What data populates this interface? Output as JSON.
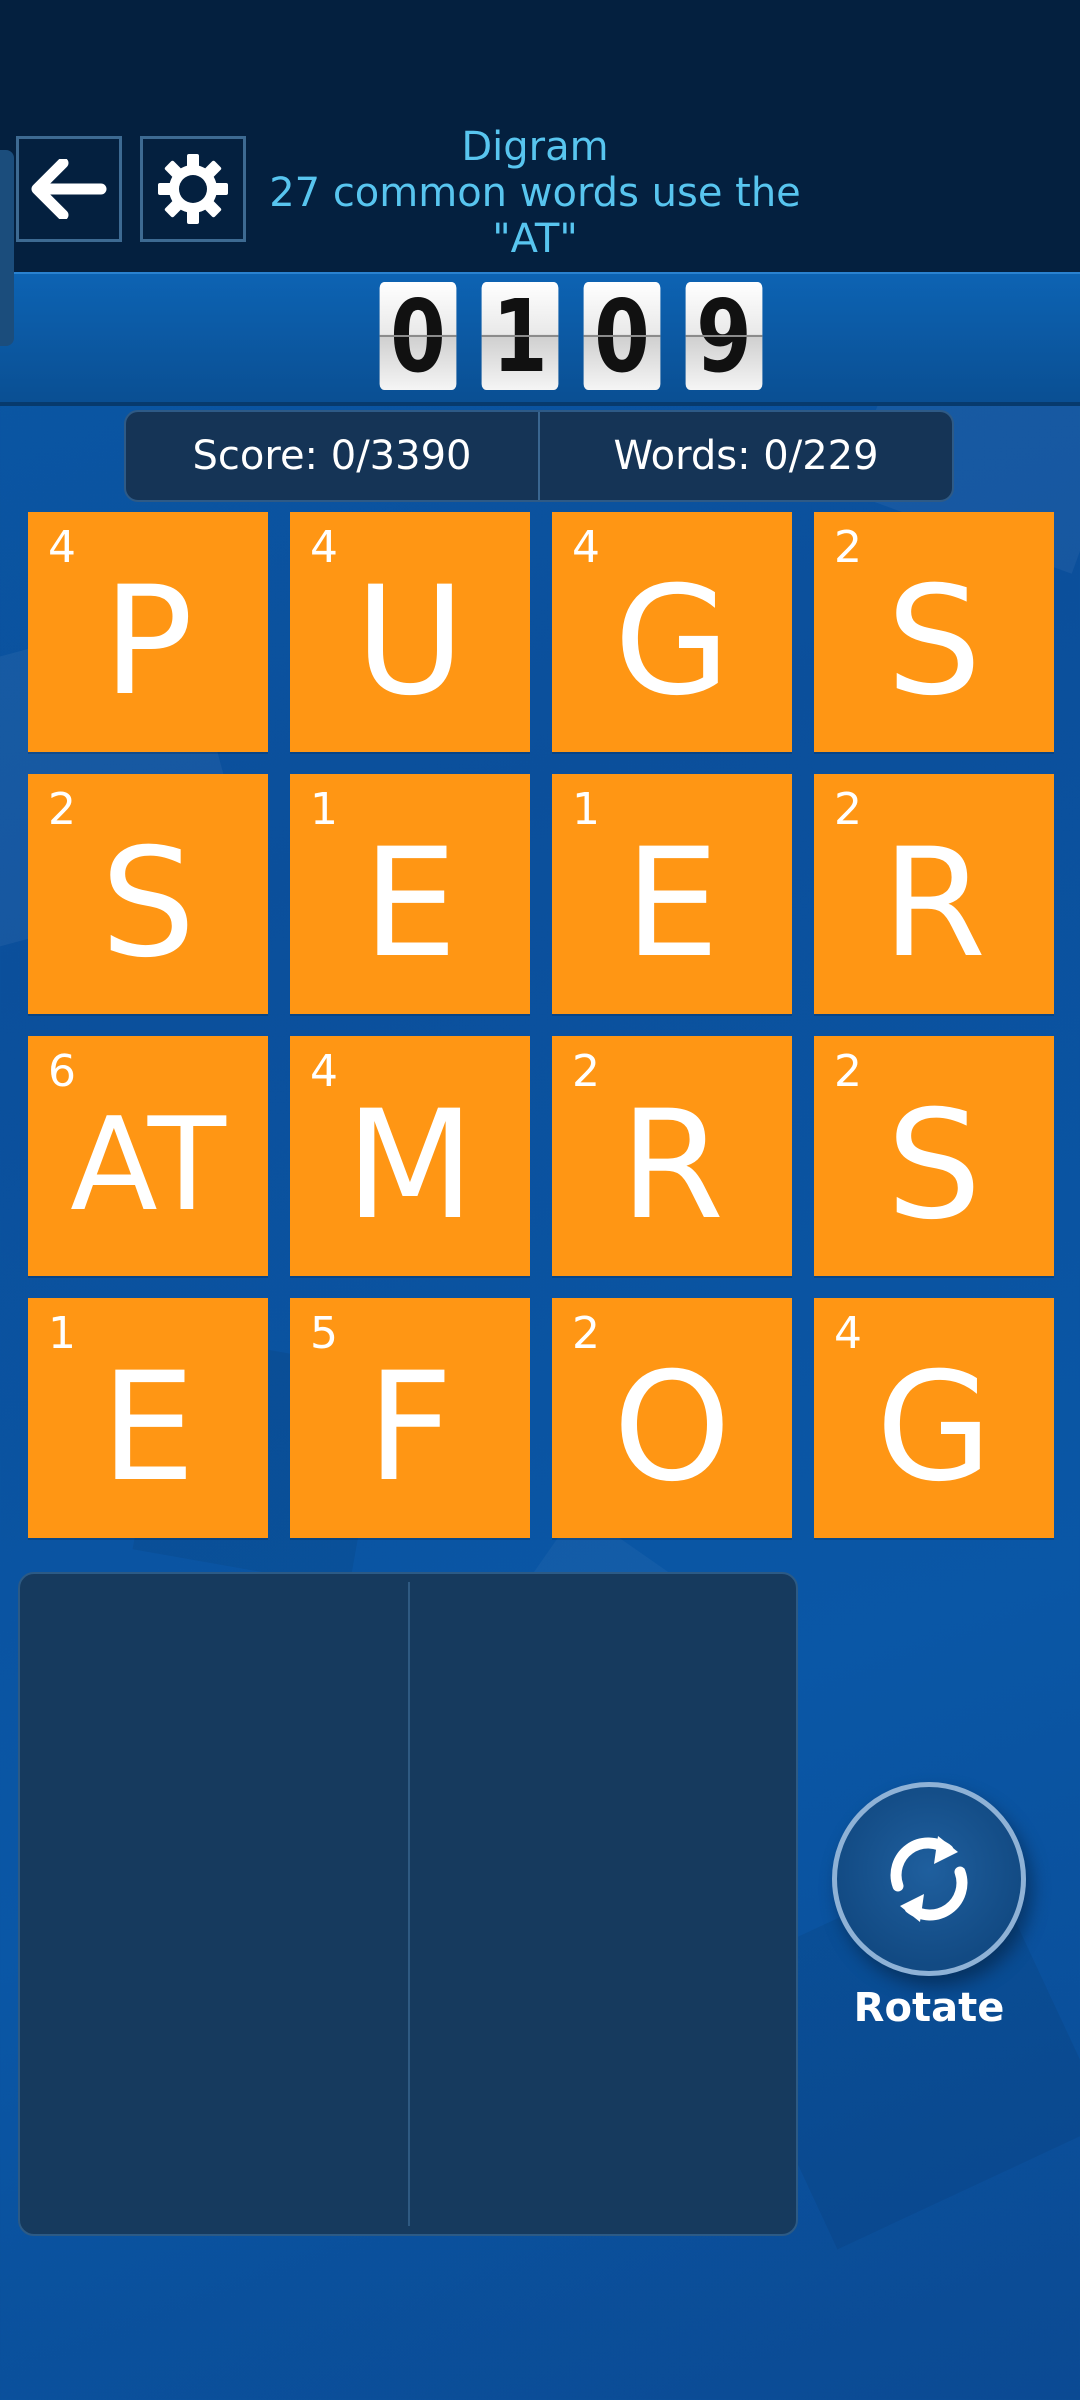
{
  "hint": {
    "title": "Digram",
    "line2": "27 common words use the",
    "line3": "\"AT\""
  },
  "timer": {
    "digits": [
      "0",
      "1",
      "0",
      "9"
    ]
  },
  "stats": {
    "score": "Score: 0/3390",
    "words": "Words: 0/229"
  },
  "board": {
    "tiles": [
      {
        "letter": "P",
        "points": "4"
      },
      {
        "letter": "U",
        "points": "4"
      },
      {
        "letter": "G",
        "points": "4"
      },
      {
        "letter": "S",
        "points": "2"
      },
      {
        "letter": "S",
        "points": "2"
      },
      {
        "letter": "E",
        "points": "1"
      },
      {
        "letter": "E",
        "points": "1"
      },
      {
        "letter": "R",
        "points": "2"
      },
      {
        "letter": "AT",
        "points": "6"
      },
      {
        "letter": "M",
        "points": "4"
      },
      {
        "letter": "R",
        "points": "2"
      },
      {
        "letter": "S",
        "points": "2"
      },
      {
        "letter": "E",
        "points": "1"
      },
      {
        "letter": "F",
        "points": "5"
      },
      {
        "letter": "O",
        "points": "2"
      },
      {
        "letter": "G",
        "points": "4"
      }
    ]
  },
  "controls": {
    "rotate_label": "Rotate",
    "back_icon": "arrow-left-icon",
    "settings_icon": "gear-icon",
    "rotate_icon": "rotate-icon"
  },
  "colors": {
    "tile": "#ff9614",
    "background": "#0b55a3",
    "topbar": "#04203f",
    "hint_text": "#58c5ef"
  }
}
